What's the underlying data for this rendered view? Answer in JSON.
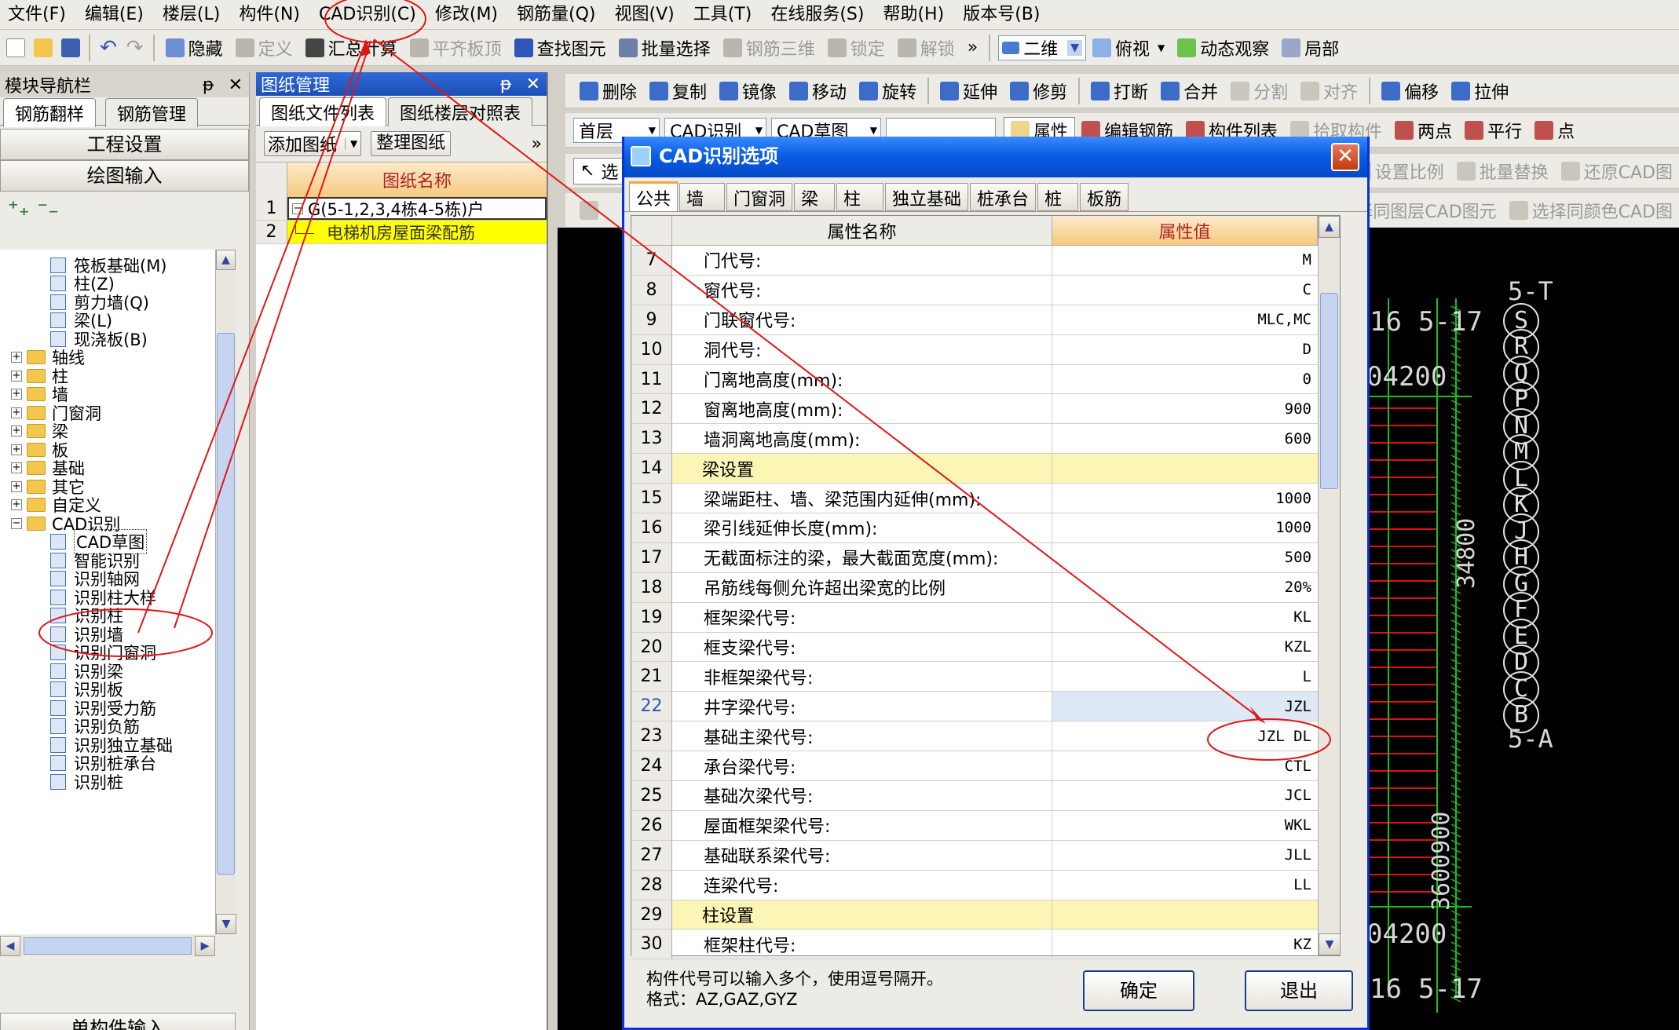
{
  "menubar": [
    "文件(F)",
    "编辑(E)",
    "楼层(L)",
    "构件(N)",
    "CAD识别(C)",
    "修改(M)",
    "钢筋量(Q)",
    "视图(V)",
    "工具(T)",
    "在线服务(S)",
    "帮助(H)",
    "版本号(B)"
  ],
  "toolbar1": {
    "items": [
      {
        "label": "隐藏",
        "icon": "eye-icon",
        "disabled": false
      },
      {
        "label": "定义",
        "icon": "define-icon",
        "disabled": true
      },
      {
        "label": "汇总计算",
        "icon": "sigma-icon",
        "disabled": false
      },
      {
        "label": "平齐板顶",
        "icon": "align-top-icon",
        "disabled": true
      },
      {
        "label": "查找图元",
        "icon": "binoculars-icon",
        "disabled": false
      },
      {
        "label": "批量选择",
        "icon": "batch-select-icon",
        "disabled": false
      },
      {
        "label": "钢筋三维",
        "icon": "rebar-3d-icon",
        "disabled": true
      },
      {
        "label": "锁定",
        "icon": "lock-icon",
        "disabled": true
      },
      {
        "label": "解锁",
        "icon": "unlock-icon",
        "disabled": true
      }
    ],
    "overflow": "»",
    "view_mode": "二维",
    "view_dir": "俯视",
    "orbit": "动态观察",
    "partial": "局部"
  },
  "toolbar2": [
    {
      "label": "删除",
      "disabled": false
    },
    {
      "label": "复制",
      "disabled": false
    },
    {
      "label": "镜像",
      "disabled": false
    },
    {
      "label": "移动",
      "disabled": false
    },
    {
      "label": "旋转",
      "disabled": false
    },
    {
      "label": "延伸",
      "disabled": false
    },
    {
      "label": "修剪",
      "disabled": false
    },
    {
      "label": "打断",
      "disabled": false
    },
    {
      "label": "合并",
      "disabled": false
    },
    {
      "label": "分割",
      "disabled": true
    },
    {
      "label": "对齐",
      "disabled": true
    },
    {
      "label": "偏移",
      "disabled": false
    },
    {
      "label": "拉伸",
      "disabled": false
    }
  ],
  "toolbar3": {
    "floor": "首层",
    "category": "CAD识别",
    "sub": "CAD草图",
    "attr_btn": "属性",
    "items": [
      {
        "label": "编辑钢筋",
        "disabled": false
      },
      {
        "label": "构件列表",
        "disabled": false
      },
      {
        "label": "拾取构件",
        "disabled": true
      },
      {
        "label": "两点",
        "disabled": false
      },
      {
        "label": "平行",
        "disabled": false
      },
      {
        "label": "点",
        "disabled": false
      }
    ]
  },
  "toolbar4": [
    {
      "label": "设置比例",
      "disabled": true
    },
    {
      "label": "批量替换",
      "disabled": true
    },
    {
      "label": "还原CAD图",
      "disabled": true
    }
  ],
  "toolbar5": [
    {
      "label": "选择同图层CAD图元",
      "disabled": true
    },
    {
      "label": "选择同颜色CAD图",
      "disabled": true
    }
  ],
  "toolbar4_select": "选",
  "nav": {
    "title": "模块导航栏",
    "tabs": [
      "钢筋翻样",
      "钢筋管理"
    ],
    "btn_project": "工程设置",
    "btn_draw": "绘图输入",
    "btn_bottom": "单构件输入",
    "tree": [
      {
        "label": "筏板基础(M)",
        "level": 2,
        "type": "item"
      },
      {
        "label": "柱(Z)",
        "level": 2,
        "type": "item"
      },
      {
        "label": "剪力墙(Q)",
        "level": 2,
        "type": "item"
      },
      {
        "label": "梁(L)",
        "level": 2,
        "type": "item"
      },
      {
        "label": "现浇板(B)",
        "level": 2,
        "type": "item"
      },
      {
        "label": "轴线",
        "level": 1,
        "type": "folder",
        "pm": "+"
      },
      {
        "label": "柱",
        "level": 1,
        "type": "folder",
        "pm": "+"
      },
      {
        "label": "墙",
        "level": 1,
        "type": "folder",
        "pm": "+"
      },
      {
        "label": "门窗洞",
        "level": 1,
        "type": "folder",
        "pm": "+"
      },
      {
        "label": "梁",
        "level": 1,
        "type": "folder",
        "pm": "+"
      },
      {
        "label": "板",
        "level": 1,
        "type": "folder",
        "pm": "+"
      },
      {
        "label": "基础",
        "level": 1,
        "type": "folder",
        "pm": "+"
      },
      {
        "label": "其它",
        "level": 1,
        "type": "folder",
        "pm": "+"
      },
      {
        "label": "自定义",
        "level": 1,
        "type": "folder",
        "pm": "+"
      },
      {
        "label": "CAD识别",
        "level": 1,
        "type": "folder",
        "pm": "−"
      },
      {
        "label": "CAD草图",
        "level": 2,
        "type": "item",
        "selected": true
      },
      {
        "label": "智能识别",
        "level": 2,
        "type": "item"
      },
      {
        "label": "识别轴网",
        "level": 2,
        "type": "item"
      },
      {
        "label": "识别柱大样",
        "level": 2,
        "type": "item"
      },
      {
        "label": "识别柱",
        "level": 2,
        "type": "item"
      },
      {
        "label": "识别墙",
        "level": 2,
        "type": "item"
      },
      {
        "label": "识别门窗洞",
        "level": 2,
        "type": "item"
      },
      {
        "label": "识别梁",
        "level": 2,
        "type": "item"
      },
      {
        "label": "识别板",
        "level": 2,
        "type": "item"
      },
      {
        "label": "识别受力筋",
        "level": 2,
        "type": "item"
      },
      {
        "label": "识别负筋",
        "level": 2,
        "type": "item"
      },
      {
        "label": "识别独立基础",
        "level": 2,
        "type": "item"
      },
      {
        "label": "识别桩承台",
        "level": 2,
        "type": "item"
      },
      {
        "label": "识别桩",
        "level": 2,
        "type": "item"
      }
    ]
  },
  "drawings": {
    "title": "图纸管理",
    "tabs": [
      "图纸文件列表",
      "图纸楼层对照表"
    ],
    "add": "添加图纸",
    "organize": "整理图纸",
    "header": "图纸名称",
    "rows": [
      {
        "num": "1",
        "name": "G(5-1,2,3,4栋4-5栋)户",
        "toggle": "−"
      },
      {
        "num": "2",
        "name": "电梯机房屋面梁配筋"
      }
    ]
  },
  "dialog": {
    "title": "CAD识别选项",
    "close": "✕",
    "tabs": [
      "公共",
      "墙",
      "门窗洞",
      "梁",
      "柱",
      "独立基础",
      "桩承台",
      "桩",
      "板筋"
    ],
    "col_name": "属性名称",
    "col_value": "属性值",
    "rows": [
      {
        "n": "7",
        "name": "门代号:",
        "value": "M"
      },
      {
        "n": "8",
        "name": "窗代号:",
        "value": "C"
      },
      {
        "n": "9",
        "name": "门联窗代号:",
        "value": "MLC,MC"
      },
      {
        "n": "10",
        "name": "洞代号:",
        "value": "D"
      },
      {
        "n": "11",
        "name": "门离地高度(mm):",
        "value": "0"
      },
      {
        "n": "12",
        "name": "窗离地高度(mm):",
        "value": "900"
      },
      {
        "n": "13",
        "name": "墙洞离地高度(mm):",
        "value": "600"
      },
      {
        "n": "14",
        "name": "梁设置",
        "value": "",
        "section": true
      },
      {
        "n": "15",
        "name": "梁端距柱、墙、梁范围内延伸(mm):",
        "value": "1000"
      },
      {
        "n": "16",
        "name": "梁引线延伸长度(mm):",
        "value": "1000"
      },
      {
        "n": "17",
        "name": "无截面标注的梁，最大截面宽度(mm):",
        "value": "500"
      },
      {
        "n": "18",
        "name": "吊筋线每侧允许超出梁宽的比例",
        "value": "20%"
      },
      {
        "n": "19",
        "name": "框架梁代号:",
        "value": "KL"
      },
      {
        "n": "20",
        "name": "框支梁代号:",
        "value": "KZL"
      },
      {
        "n": "21",
        "name": "非框架梁代号:",
        "value": "L"
      },
      {
        "n": "22",
        "name": "井字梁代号:",
        "value": "JZL",
        "selected": true
      },
      {
        "n": "23",
        "name": "基础主梁代号:",
        "value": "JZL DL"
      },
      {
        "n": "24",
        "name": "承台梁代号:",
        "value": "CTL"
      },
      {
        "n": "25",
        "name": "基础次梁代号:",
        "value": "JCL"
      },
      {
        "n": "26",
        "name": "屋面框架梁代号:",
        "value": "WKL"
      },
      {
        "n": "27",
        "name": "基础联系梁代号:",
        "value": "JLL"
      },
      {
        "n": "28",
        "name": "连梁代号:",
        "value": "LL"
      },
      {
        "n": "29",
        "name": "柱设置",
        "value": "",
        "section": true
      },
      {
        "n": "30",
        "name": "框架柱代号:",
        "value": "KZ"
      }
    ],
    "hint1": "构件代号可以输入多个，使用逗号隔开。",
    "hint2": "格式：AZ,GAZ,GYZ",
    "ok": "确定",
    "exit": "退出"
  },
  "cad": {
    "labels_top": [
      "16",
      "5-17"
    ],
    "labels_bottom": [
      "16",
      "5-17"
    ],
    "dim_top": "04200",
    "dim_bottom": "04200",
    "dim_vertical": "34800",
    "dim_vertical2": "3600900",
    "axes": [
      "5-T",
      "S",
      "R",
      "Q",
      "P",
      "N",
      "M",
      "L",
      "K",
      "J",
      "H",
      "G",
      "F",
      "E",
      "D",
      "C",
      "B",
      "5-A"
    ]
  }
}
